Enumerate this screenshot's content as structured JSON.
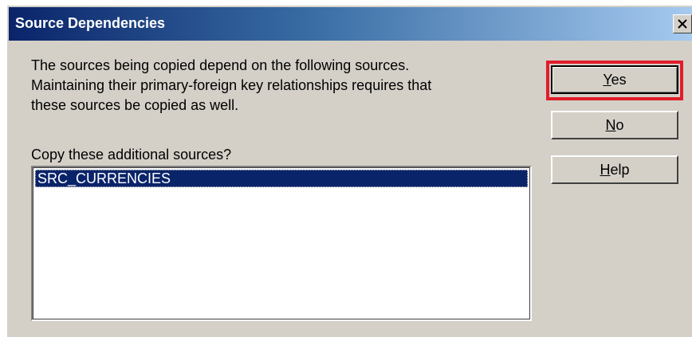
{
  "dialog": {
    "title": "Source Dependencies",
    "close_symbol": "×"
  },
  "message": {
    "lines": [
      "The sources being copied depend on the following sources.",
      "Maintaining their primary-foreign key relationships requires that",
      "these sources be copied as well."
    ]
  },
  "prompt": "Copy these additional sources?",
  "sources_list": {
    "items": [
      {
        "label": "SRC_CURRENCIES",
        "selected": true
      }
    ]
  },
  "buttons": {
    "yes": {
      "mnemonic": "Y",
      "rest": "es"
    },
    "no": {
      "mnemonic": "N",
      "rest": "o"
    },
    "help": {
      "mnemonic": "H",
      "rest": "elp"
    }
  },
  "colors": {
    "title_bar_start": "#0a246a",
    "title_bar_end": "#a6caf0",
    "dialog_background": "#d4d0c8",
    "selection": "#0a246a",
    "highlight_box": "#e11d2a"
  },
  "icons": {
    "close": "close-icon"
  }
}
